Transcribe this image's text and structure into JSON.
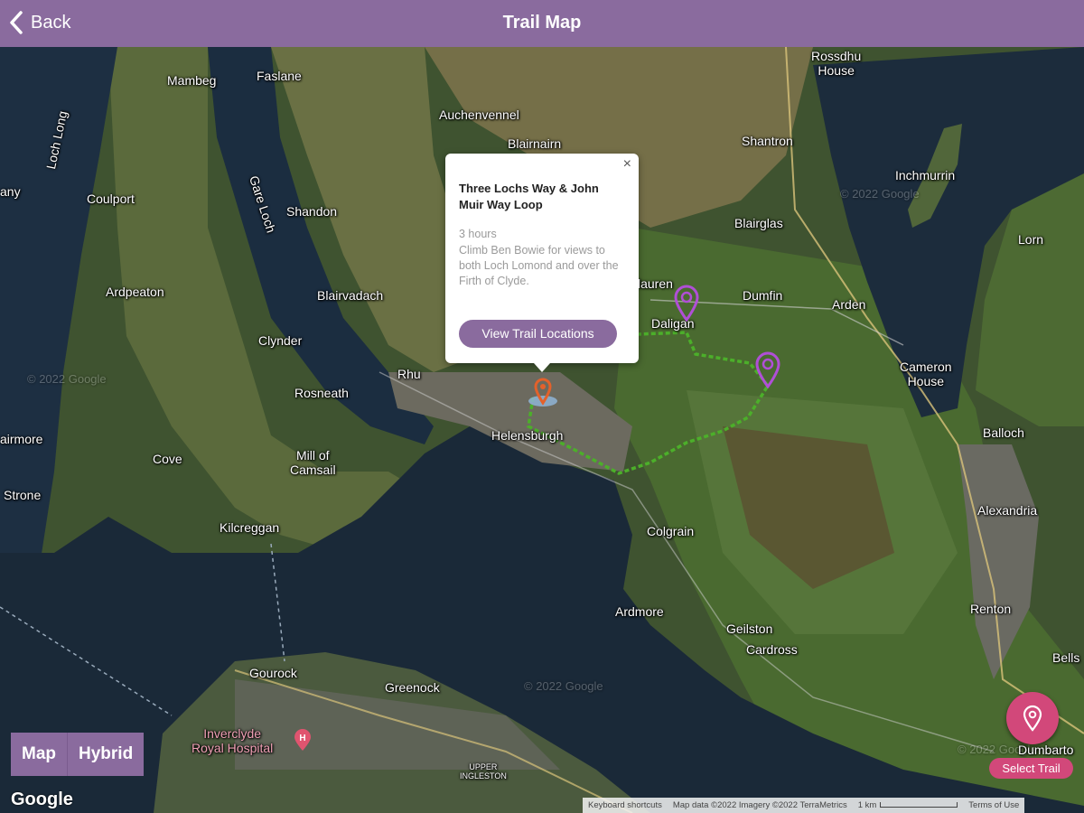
{
  "header": {
    "back_label": "Back",
    "title": "Trail Map"
  },
  "map": {
    "places": [
      {
        "id": "faslane",
        "text": "Faslane"
      },
      {
        "id": "mambeg",
        "text": "Mambeg"
      },
      {
        "id": "rossdhu",
        "text": "Rossdhu\nHouse"
      },
      {
        "id": "auchenvennel",
        "text": "Auchenvennel"
      },
      {
        "id": "blairnairn",
        "text": "Blairnairn"
      },
      {
        "id": "shantron",
        "text": "Shantron"
      },
      {
        "id": "inchmurrin",
        "text": "Inchmurrin"
      },
      {
        "id": "loch_long",
        "text": "Loch Long"
      },
      {
        "id": "any",
        "text": "any"
      },
      {
        "id": "coulport",
        "text": "Coulport"
      },
      {
        "id": "gare_loch",
        "text": "Gare Loch"
      },
      {
        "id": "shandon",
        "text": "Shandon"
      },
      {
        "id": "blairglas",
        "text": "Blairglas"
      },
      {
        "id": "lorn",
        "text": "Lorn"
      },
      {
        "id": "ardpeaton",
        "text": "Ardpeaton"
      },
      {
        "id": "blairvadach",
        "text": "Blairvadach"
      },
      {
        "id": "lauren",
        "text": "lauren"
      },
      {
        "id": "dumfin",
        "text": "Dumfin"
      },
      {
        "id": "arden",
        "text": "Arden"
      },
      {
        "id": "daligan",
        "text": "Daligan"
      },
      {
        "id": "clynder",
        "text": "Clynder"
      },
      {
        "id": "cameron",
        "text": "Cameron\nHouse"
      },
      {
        "id": "rhu",
        "text": "Rhu"
      },
      {
        "id": "rosneath",
        "text": "Rosneath"
      },
      {
        "id": "helensburgh",
        "text": "Helensburgh"
      },
      {
        "id": "balloch",
        "text": "Balloch"
      },
      {
        "id": "airmore",
        "text": "airmore"
      },
      {
        "id": "cove",
        "text": "Cove"
      },
      {
        "id": "mill_camsail",
        "text": "Mill of\nCamsail"
      },
      {
        "id": "strone",
        "text": "Strone"
      },
      {
        "id": "alexandria",
        "text": "Alexandria"
      },
      {
        "id": "kilcreggan",
        "text": "Kilcreggan"
      },
      {
        "id": "colgrain",
        "text": "Colgrain"
      },
      {
        "id": "renton",
        "text": "Renton"
      },
      {
        "id": "ardmore",
        "text": "Ardmore"
      },
      {
        "id": "geilston",
        "text": "Geilston"
      },
      {
        "id": "cardross",
        "text": "Cardross"
      },
      {
        "id": "bells",
        "text": "Bells"
      },
      {
        "id": "gourock",
        "text": "Gourock"
      },
      {
        "id": "greenock",
        "text": "Greenock"
      },
      {
        "id": "inverclyde",
        "text": "Inverclyde\nRoyal Hospital"
      },
      {
        "id": "dumbarton",
        "text": "Dumbarto"
      },
      {
        "id": "upper_ingleston",
        "text": "UPPER\nINGLESTON"
      }
    ],
    "watermarks": [
      "© 2022 Google",
      "© 2022 Google",
      "© 2022 Google",
      "© 2022 Google"
    ]
  },
  "popup": {
    "close_label": "×",
    "title": "Three Lochs Way & John Muir Way Loop",
    "duration": "3 hours",
    "description": "Climb Ben Bowie for views to both Loch Lomond and over the Firth of Clyde.",
    "button_label": "View Trail Locations"
  },
  "map_type": {
    "map_label": "Map",
    "hybrid_label": "Hybrid",
    "selected": "Hybrid"
  },
  "google_logo": "Google",
  "select_trail_label": "Select Trail",
  "attribution": {
    "shortcuts": "Keyboard shortcuts",
    "data": "Map data ©2022 Imagery ©2022 TerraMetrics",
    "scale": "1 km",
    "terms": "Terms of Use"
  },
  "colors": {
    "header": "#8a6b9e",
    "trail": "#4caf2a",
    "marker_purple": "#b04fd6",
    "marker_orange": "#e3612b",
    "select_trail": "#d2487a"
  },
  "icons": [
    "chevron-left-icon",
    "map-pin-icon",
    "close-icon",
    "hospital-icon"
  ]
}
